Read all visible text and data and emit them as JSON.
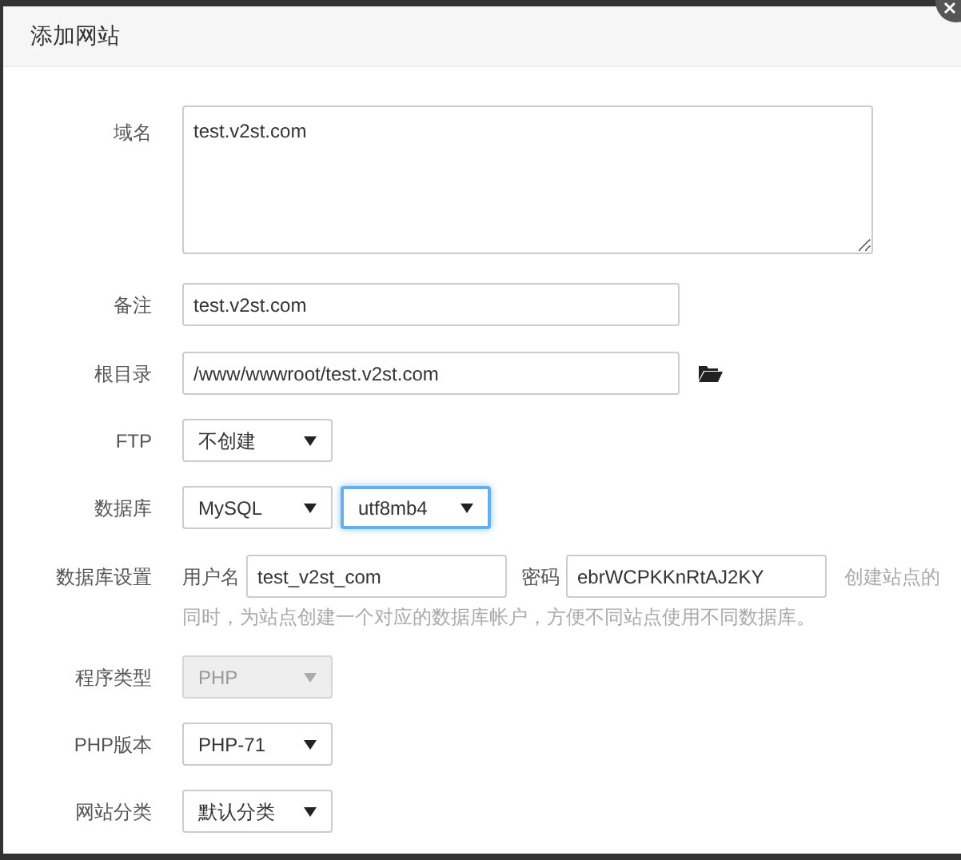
{
  "dialog": {
    "title": "添加网站"
  },
  "rows": [
    {
      "kind": "textarea",
      "label": "域名",
      "value": "test.v2st.com"
    },
    {
      "kind": "input",
      "label": "备注",
      "value": "test.v2st.com"
    },
    {
      "kind": "path",
      "label": "根目录",
      "value": "/www/wwwroot/test.v2st.com"
    },
    {
      "kind": "selects",
      "label": "FTP",
      "selects": [
        {
          "value": "不创建",
          "disabled": false,
          "focused": false
        }
      ]
    },
    {
      "kind": "selects",
      "label": "数据库",
      "selects": [
        {
          "value": "MySQL",
          "disabled": false,
          "focused": false
        },
        {
          "value": "utf8mb4",
          "disabled": false,
          "focused": true
        }
      ]
    },
    {
      "kind": "dbsettings",
      "label": "数据库设置",
      "user_label": "用户名",
      "user": "test_v2st_com",
      "password_label": "密码",
      "password": "ebrWCPKKnRtAJ2KY",
      "hint_lines": [
        "创建站点的",
        "同时，为站点创建一个对应的数据库帐户，方便不同站点使用不同数据库。"
      ]
    },
    {
      "kind": "selects",
      "label": "程序类型",
      "selects": [
        {
          "value": "PHP",
          "disabled": true,
          "focused": false
        }
      ]
    },
    {
      "kind": "selects",
      "label": "PHP版本",
      "selects": [
        {
          "value": "PHP-71",
          "disabled": false,
          "focused": false
        }
      ]
    },
    {
      "kind": "selects",
      "label": "网站分类",
      "selects": [
        {
          "value": "默认分类",
          "disabled": false,
          "focused": false
        }
      ]
    }
  ]
}
